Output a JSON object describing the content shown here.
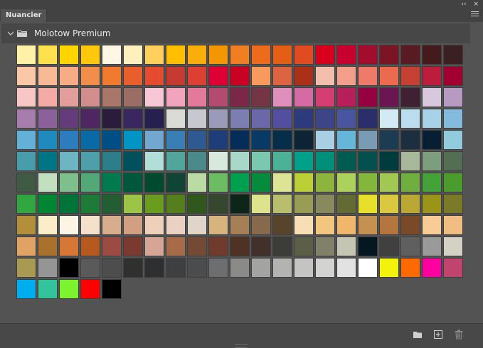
{
  "window": {
    "collapse_glyph": "‹‹",
    "close_glyph": "×"
  },
  "tab": {
    "label": "Nuancier"
  },
  "group": {
    "name": "Molotow Premium"
  },
  "swatches": [
    "#FFF1A6",
    "#FFE14D",
    "#FFD500",
    "#FFC80A",
    "#FFF6E4",
    "#FFF0BE",
    "#FFD15C",
    "#FFBE00",
    "#F9AE0B",
    "#F49504",
    "#F07F23",
    "#EE6B1B",
    "#E45E16",
    "#E24A21",
    "#D9001E",
    "#C8002E",
    "#A20D2E",
    "#7B1424",
    "#581B21",
    "#451A1D",
    "#3A2022",
    "#FAC7A7",
    "#F8BA96",
    "#F7AC86",
    "#F18E4C",
    "#F07A2E",
    "#E95F2C",
    "#E54B2E",
    "#C63A31",
    "#DD3F33",
    "#DE0034",
    "#C90021",
    "#F89A5C",
    "#DD6443",
    "#AA3118",
    "#F4BEAD",
    "#F49F8C",
    "#F07A6A",
    "#EB6B4E",
    "#C74034",
    "#BD1D3C",
    "#A30032",
    "#F8C7C5",
    "#F4AAA5",
    "#E29E9A",
    "#D18E8C",
    "#A87769",
    "#9B6E65",
    "#F8C7D5",
    "#F2A4BE",
    "#E37A9B",
    "#B34A6F",
    "#7A2748",
    "#743645",
    "#E08EBB",
    "#D46BA4",
    "#D53E72",
    "#B71F5B",
    "#960241",
    "#6B1652",
    "#402133",
    "#D8C8DE",
    "#B69AC1",
    "#A67DAD",
    "#8B609B",
    "#643C7C",
    "#4E2662",
    "#2B1C3B",
    "#3A275F",
    "#262050",
    "#DADBD6",
    "#C7C7D0",
    "#9A9BBB",
    "#7C7EB2",
    "#6A68A8",
    "#544EA0",
    "#2E3A7E",
    "#3D4588",
    "#4A55A0",
    "#2A2E6A",
    "#D3E9F3",
    "#BADEEE",
    "#A8D2E8",
    "#84BADB",
    "#64B1D8",
    "#1E8ABE",
    "#2D7CBD",
    "#0A6AA6",
    "#004E86",
    "#0394C6",
    "#72A8D0",
    "#3A7EB6",
    "#2F5A91",
    "#1F3D78",
    "#042D5A",
    "#083A65",
    "#062E4B",
    "#0D2436",
    "#A8CFE3",
    "#66B6D9",
    "#7A9BB4",
    "#1B3C53",
    "#1C2E3F",
    "#071E33",
    "#92CCDC",
    "#479DAA",
    "#007585",
    "#6EB5C4",
    "#4D9FA9",
    "#2C7E8B",
    "#00505E",
    "#B2DED8",
    "#51A59B",
    "#4A8A8B",
    "#D7E9DC",
    "#A8D9C8",
    "#7BC8B0",
    "#4BB197",
    "#00A08A",
    "#00907A",
    "#005B51",
    "#04504E",
    "#003C3E",
    "#A8B89A",
    "#7D9E7E",
    "#546E53",
    "#3F5B44",
    "#C2DFC0",
    "#7DC08C",
    "#52A977",
    "#007A4E",
    "#00583C",
    "#004A30",
    "#104435",
    "#BBDBA5",
    "#6CBC64",
    "#00A04F",
    "#058B3B",
    "#DDE496",
    "#BBD036",
    "#8DB43C",
    "#ACD25C",
    "#83B73C",
    "#A0C852",
    "#6EAF3F",
    "#43A238",
    "#4A9D2C",
    "#31A741",
    "#008633",
    "#007338",
    "#1E7B37",
    "#225E32",
    "#9CC548",
    "#6A9D1E",
    "#557F1D",
    "#31581C",
    "#35472E",
    "#0E2619",
    "#DDE28D",
    "#B9BE6F",
    "#999C54",
    "#888A5D",
    "#636A33",
    "#E8DE2C",
    "#D9C840",
    "#B9A934",
    "#9A9418",
    "#7B7A28",
    "#B38E3B",
    "#FCEDC9",
    "#FCF4E4",
    "#F4E0CB",
    "#D7AD8E",
    "#D39F82",
    "#EED0BB",
    "#EAD1C3",
    "#E0D5CB",
    "#D7B37D",
    "#A58057",
    "#866A4B",
    "#58432B",
    "#F8DEB4",
    "#F3C680",
    "#F0B76C",
    "#C59151",
    "#B4763E",
    "#7A4A28",
    "#F9CC95",
    "#F0BD83",
    "#E0A363",
    "#A9712C",
    "#D77735",
    "#B6591F",
    "#9C4B43",
    "#7A3A2F",
    "#D6A596",
    "#A86B4A",
    "#754A34",
    "#6E3B2C",
    "#4F3223",
    "#42302A",
    "#3C3C39",
    "#5D5E47",
    "#808168",
    "#C5C5B3",
    "#041822",
    "#404040",
    "#5F5F5F",
    "#9A9A9A",
    "#D4D2C4",
    "#A99A51",
    "#959595",
    "#000000",
    "#5A5A5A",
    "#4D4D4D",
    "#30312E",
    "#2D2F31",
    "#3D3F41",
    "#4A4C4E",
    "#6D6E6F",
    "#8A8A89",
    "#A3A3A1",
    "#B3B3B1",
    "#C4C4C2",
    "#D3D3D1",
    "#E2E2E2",
    "#FFFFFF",
    "#F2F20D",
    "#FF6A00",
    "#FF00A0",
    "#C0446E",
    "#00ADEE",
    "#34C49C",
    "#7DF22F",
    "#FF0000",
    "#000000"
  ]
}
